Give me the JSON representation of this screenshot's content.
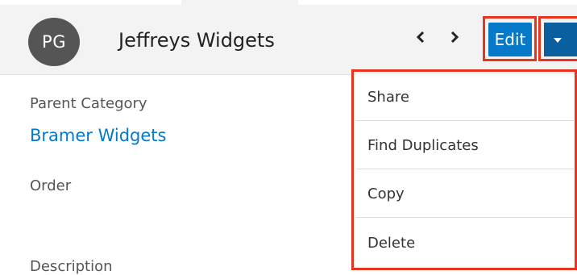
{
  "record": {
    "avatar_initials": "PG",
    "title": "Jeffreys Widgets"
  },
  "header": {
    "prev_icon": "chevron-left-icon",
    "next_icon": "chevron-right-icon",
    "edit_label": "Edit",
    "actions_icon": "caret-down-icon"
  },
  "fields": {
    "parent_category_label": "Parent Category",
    "parent_category_value": "Bramer Widgets",
    "order_label": "Order",
    "description_label": "Description"
  },
  "actions_menu": {
    "items": [
      {
        "label": "Share"
      },
      {
        "label": "Find Duplicates"
      },
      {
        "label": "Copy"
      },
      {
        "label": "Delete"
      }
    ]
  },
  "colors": {
    "primary_button": "#0679c8",
    "dropdown_button": "#0a5f9f",
    "highlight_outline": "#e8341c",
    "link": "#0679c8"
  }
}
